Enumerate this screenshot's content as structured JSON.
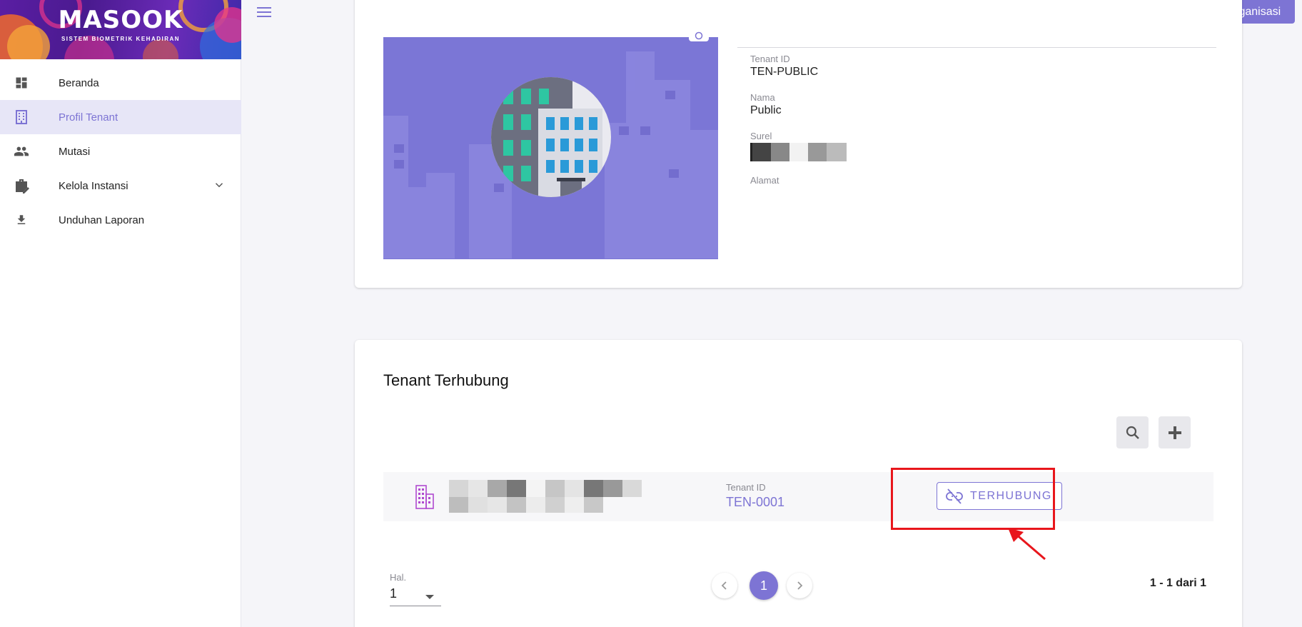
{
  "brand": {
    "name": "MASOOK",
    "tagline": "SISTEM BIOMETRIK KEHADIRAN"
  },
  "sidebar": {
    "items": [
      {
        "label": "Beranda",
        "icon": "dashboard-icon"
      },
      {
        "label": "Profil Tenant",
        "icon": "building-icon",
        "active": true
      },
      {
        "label": "Mutasi",
        "icon": "people-icon"
      },
      {
        "label": "Kelola Instansi",
        "icon": "work-edit-icon",
        "expandable": true
      },
      {
        "label": "Unduhan Laporan",
        "icon": "download-icon"
      }
    ]
  },
  "header": {
    "org_button_label": "Pilih Organisasi"
  },
  "profile": {
    "fields": [
      {
        "label": "Tenant ID",
        "value": "TEN-PUBLIC"
      },
      {
        "label": "Nama",
        "value": "Public"
      },
      {
        "label": "Surel",
        "value": ""
      },
      {
        "label": "Alamat",
        "value": ""
      }
    ]
  },
  "linked": {
    "title": "Tenant Terhubung",
    "rows": [
      {
        "tenant_id_label": "Tenant ID",
        "tenant_id": "TEN-0001",
        "status_label": "TERHUBUNG"
      }
    ],
    "pagination": {
      "page_label": "Hal.",
      "page_value": "1",
      "current_page": "1",
      "range_text": "1 - 1 dari 1"
    }
  },
  "colors": {
    "accent": "#7d74d4",
    "highlight": "#e8161c"
  }
}
